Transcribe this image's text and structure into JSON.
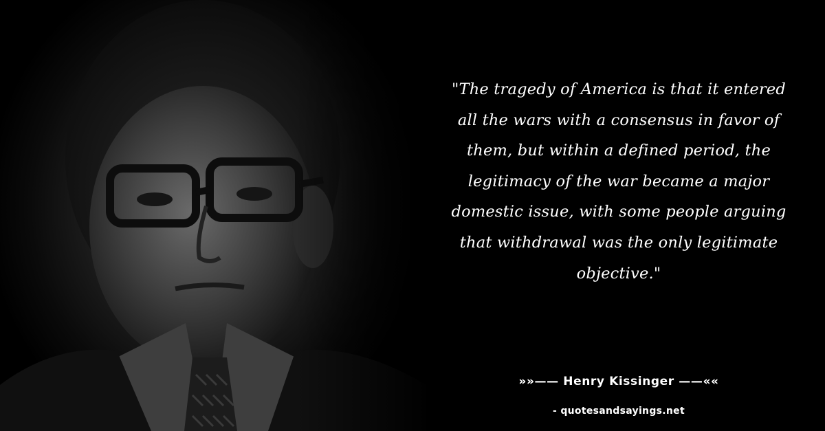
{
  "quote": {
    "lines": [
      "\"The tragedy of America is that it entered",
      "all the wars with a consensus in favor of",
      "them, but within a defined period, the",
      "legitimacy of the war became a major",
      "domestic issue, with some people arguing",
      "that withdrawal was the only legitimate",
      "objective.\""
    ]
  },
  "attribution": {
    "author_line": "»»—— Henry Kissinger ——««"
  },
  "source": {
    "site": "- quotesandsayings.net"
  },
  "colors": {
    "background": "#000000",
    "text": "#ffffff"
  }
}
